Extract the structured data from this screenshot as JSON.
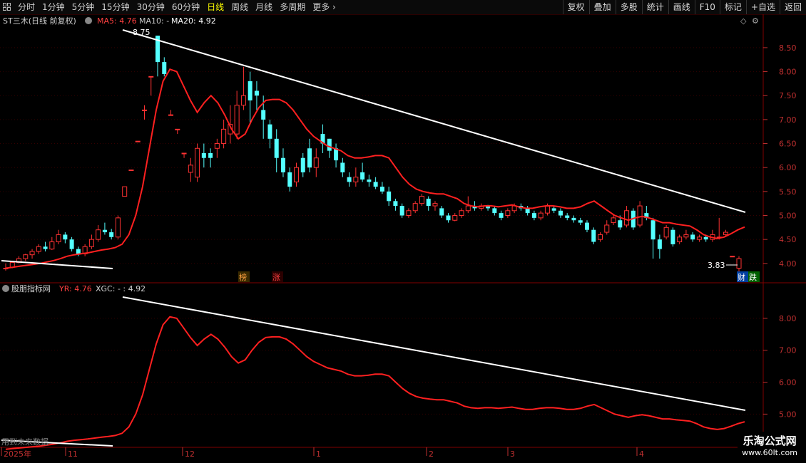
{
  "toolbar": {
    "periods": [
      "分时",
      "1分钟",
      "5分钟",
      "15分钟",
      "30分钟",
      "60分钟",
      "日线",
      "周线",
      "月线",
      "多周期",
      "更多"
    ],
    "active_period": "日线",
    "buttons": [
      "复权",
      "叠加",
      "多股",
      "统计",
      "画线",
      "F10",
      "标记",
      "+自选",
      "返回"
    ]
  },
  "main_panel": {
    "title": "ST三木(日线 前复权)",
    "ma5_label": "MA5: 4.76",
    "ma10_label": "MA10: -",
    "ma20_label": "MA20: 4.92",
    "high_marker": "8.75",
    "low_marker": "3.83",
    "tags": [
      "榜",
      "涨",
      "财",
      "跌"
    ]
  },
  "sub_panel": {
    "title": "股朋指标网",
    "yr_label": "YR: 4.76",
    "xgc_label": "XGC: - : 4.92",
    "footer_text": "用到未来数据"
  },
  "watermark": {
    "title": "乐淘公式网",
    "url": "www.60lt.com"
  },
  "colors": {
    "up": "#ff3232",
    "down": "#54ffff",
    "ma_line": "#ff2020",
    "trend_line": "#ffffff",
    "axis": "#c03030"
  },
  "chart_data": [
    {
      "type": "candlestick",
      "title": "ST三木(日线 前复权)",
      "y_ticks": [
        "8.50",
        "8.00",
        "7.50",
        "7.00",
        "6.50",
        "6.00",
        "5.50",
        "5.00",
        "4.50",
        "4.00"
      ],
      "x_ticks": [
        "2025年",
        "11",
        "12",
        "1",
        "2",
        "3",
        "4"
      ],
      "ylim": [
        3.7,
        8.9
      ],
      "series": [
        {
          "name": "MA5",
          "last": 4.76
        },
        {
          "name": "MA20",
          "last": 4.92
        }
      ],
      "candles": [
        [
          3.9,
          3.9,
          4.0,
          3.85
        ],
        [
          3.92,
          4.02,
          4.05,
          3.9
        ],
        [
          4.02,
          4.1,
          4.15,
          4.0
        ],
        [
          4.1,
          4.18,
          4.2,
          4.05
        ],
        [
          4.18,
          4.25,
          4.3,
          4.1
        ],
        [
          4.25,
          4.35,
          4.4,
          4.2
        ],
        [
          4.35,
          4.3,
          4.45,
          4.25
        ],
        [
          4.3,
          4.45,
          4.55,
          4.28
        ],
        [
          4.45,
          4.6,
          4.7,
          4.4
        ],
        [
          4.6,
          4.5,
          4.65,
          4.42
        ],
        [
          4.5,
          4.3,
          4.55,
          4.25
        ],
        [
          4.3,
          4.2,
          4.35,
          4.15
        ],
        [
          4.2,
          4.35,
          4.4,
          4.15
        ],
        [
          4.35,
          4.5,
          4.6,
          4.3
        ],
        [
          4.5,
          4.7,
          4.8,
          4.45
        ],
        [
          4.7,
          4.65,
          4.85,
          4.6
        ],
        [
          4.65,
          4.55,
          4.72,
          4.5
        ],
        [
          4.55,
          4.95,
          5.0,
          4.5
        ],
        [
          5.4,
          5.6,
          5.6,
          5.4
        ],
        [
          5.95,
          5.95,
          5.95,
          5.95
        ],
        [
          6.55,
          6.55,
          6.55,
          6.55
        ],
        [
          7.2,
          7.2,
          7.3,
          7.0
        ],
        [
          7.9,
          7.9,
          7.9,
          7.5
        ],
        [
          8.75,
          8.2,
          8.75,
          7.9
        ],
        [
          8.2,
          7.95,
          8.3,
          7.9
        ],
        [
          7.1,
          7.1,
          7.2,
          7.1
        ],
        [
          6.8,
          6.8,
          6.8,
          6.7
        ],
        [
          6.3,
          6.3,
          6.3,
          6.2
        ],
        [
          5.9,
          6.05,
          6.2,
          5.7
        ],
        [
          5.8,
          6.4,
          6.5,
          5.7
        ],
        [
          6.3,
          6.2,
          6.5,
          6.0
        ],
        [
          6.3,
          6.2,
          6.4,
          6.0
        ],
        [
          6.4,
          6.5,
          6.6,
          6.2
        ],
        [
          6.5,
          6.8,
          7.0,
          6.4
        ],
        [
          6.7,
          6.9,
          7.3,
          6.5
        ],
        [
          6.7,
          7.3,
          7.6,
          6.6
        ],
        [
          7.3,
          7.5,
          8.1,
          7.2
        ],
        [
          7.8,
          7.4,
          8.0,
          6.9
        ],
        [
          7.6,
          7.5,
          7.8,
          7.2
        ],
        [
          7.2,
          7.0,
          7.5,
          6.6
        ],
        [
          6.9,
          6.6,
          7.0,
          6.4
        ],
        [
          6.6,
          6.2,
          6.8,
          5.9
        ],
        [
          6.2,
          5.9,
          6.4,
          5.8
        ],
        [
          5.9,
          5.6,
          6.0,
          5.5
        ],
        [
          5.7,
          6.0,
          6.1,
          5.6
        ],
        [
          6.2,
          5.9,
          6.3,
          5.8
        ],
        [
          6.4,
          6.0,
          6.6,
          5.9
        ],
        [
          6.0,
          6.2,
          6.4,
          5.8
        ],
        [
          6.7,
          6.5,
          6.9,
          6.3
        ],
        [
          6.6,
          6.35,
          6.6,
          6.2
        ],
        [
          6.4,
          6.15,
          6.5,
          6.0
        ],
        [
          6.1,
          5.9,
          6.2,
          5.8
        ],
        [
          5.8,
          5.7,
          5.9,
          5.6
        ],
        [
          5.7,
          5.8,
          6.0,
          5.6
        ],
        [
          5.9,
          5.75,
          6.1,
          5.7
        ],
        [
          5.75,
          5.7,
          5.85,
          5.6
        ],
        [
          5.7,
          5.6,
          5.8,
          5.55
        ],
        [
          5.6,
          5.5,
          5.7,
          5.45
        ],
        [
          5.5,
          5.3,
          5.6,
          5.2
        ],
        [
          5.3,
          5.2,
          5.35,
          5.1
        ],
        [
          5.2,
          5.0,
          5.25,
          4.95
        ],
        [
          5.0,
          5.1,
          5.15,
          4.95
        ],
        [
          5.1,
          5.25,
          5.3,
          5.05
        ],
        [
          5.25,
          5.4,
          5.45,
          5.2
        ],
        [
          5.35,
          5.2,
          5.4,
          5.1
        ],
        [
          5.2,
          5.25,
          5.3,
          5.1
        ],
        [
          5.15,
          5.0,
          5.2,
          4.95
        ],
        [
          5.0,
          4.9,
          5.05,
          4.85
        ],
        [
          4.9,
          5.0,
          5.05,
          4.88
        ],
        [
          5.0,
          5.1,
          5.15,
          4.95
        ],
        [
          5.1,
          5.2,
          5.4,
          5.05
        ],
        [
          5.2,
          5.15,
          5.3,
          5.1
        ],
        [
          5.15,
          5.2,
          5.25,
          5.1
        ],
        [
          5.2,
          5.15,
          5.22,
          5.1
        ],
        [
          5.15,
          5.05,
          5.2,
          5.0
        ],
        [
          5.05,
          4.95,
          5.1,
          4.9
        ],
        [
          5.0,
          5.1,
          5.15,
          4.95
        ],
        [
          5.1,
          5.2,
          5.25,
          5.05
        ],
        [
          5.2,
          5.15,
          5.25,
          5.1
        ],
        [
          5.15,
          5.05,
          5.2,
          5.0
        ],
        [
          5.05,
          4.95,
          5.1,
          4.9
        ],
        [
          4.95,
          5.05,
          5.1,
          4.9
        ],
        [
          5.05,
          5.2,
          5.25,
          5.0
        ],
        [
          5.15,
          5.1,
          5.2,
          5.05
        ],
        [
          5.1,
          5.0,
          5.15,
          4.95
        ],
        [
          5.0,
          4.95,
          5.05,
          4.9
        ],
        [
          4.95,
          4.9,
          5.0,
          4.85
        ],
        [
          4.9,
          4.85,
          4.95,
          4.8
        ],
        [
          4.85,
          4.7,
          4.9,
          4.65
        ],
        [
          4.7,
          4.45,
          4.75,
          4.4
        ],
        [
          4.5,
          4.6,
          4.65,
          4.45
        ],
        [
          4.65,
          4.8,
          4.9,
          4.6
        ],
        [
          4.85,
          4.95,
          5.0,
          4.8
        ],
        [
          4.9,
          4.75,
          5.0,
          4.7
        ],
        [
          4.8,
          5.1,
          5.2,
          4.75
        ],
        [
          5.1,
          4.75,
          5.15,
          4.7
        ],
        [
          4.8,
          5.2,
          5.3,
          4.75
        ],
        [
          5.05,
          4.95,
          5.2,
          4.9
        ],
        [
          4.9,
          4.5,
          4.95,
          4.1
        ],
        [
          4.5,
          4.3,
          4.6,
          4.1
        ],
        [
          4.55,
          4.75,
          4.8,
          4.5
        ],
        [
          4.7,
          4.4,
          4.75,
          4.35
        ],
        [
          4.45,
          4.55,
          4.6,
          4.4
        ],
        [
          4.55,
          4.6,
          4.7,
          4.5
        ],
        [
          4.6,
          4.5,
          4.65,
          4.45
        ],
        [
          4.5,
          4.55,
          4.6,
          4.45
        ],
        [
          4.55,
          4.5,
          4.6,
          4.45
        ],
        [
          4.5,
          4.6,
          4.7,
          4.45
        ],
        [
          4.55,
          4.55,
          4.95,
          4.5
        ],
        [
          4.6,
          4.65,
          4.7,
          4.55
        ],
        [
          4.15,
          4.15,
          4.15,
          4.15
        ],
        [
          3.9,
          4.1,
          4.15,
          3.83
        ]
      ],
      "ma_line": [
        3.9,
        3.92,
        3.94,
        3.96,
        3.98,
        4.0,
        4.03,
        4.06,
        4.1,
        4.15,
        4.18,
        4.2,
        4.22,
        4.25,
        4.28,
        4.3,
        4.33,
        4.4,
        4.6,
        5.0,
        5.6,
        6.4,
        7.2,
        7.8,
        8.05,
        8.0,
        7.7,
        7.4,
        7.15,
        7.35,
        7.5,
        7.35,
        7.1,
        6.8,
        6.6,
        6.7,
        7.0,
        7.25,
        7.4,
        7.42,
        7.42,
        7.35,
        7.2,
        7.0,
        6.8,
        6.65,
        6.55,
        6.45,
        6.4,
        6.35,
        6.25,
        6.2,
        6.2,
        6.22,
        6.25,
        6.25,
        6.2,
        6.0,
        5.8,
        5.65,
        5.55,
        5.5,
        5.47,
        5.45,
        5.45,
        5.4,
        5.35,
        5.25,
        5.2,
        5.18,
        5.2,
        5.2,
        5.18,
        5.2,
        5.22,
        5.18,
        5.15,
        5.15,
        5.18,
        5.2,
        5.2,
        5.18,
        5.15,
        5.15,
        5.18,
        5.25,
        5.3,
        5.2,
        5.1,
        5.0,
        4.95,
        4.9,
        4.95,
        4.98,
        4.95,
        4.9,
        4.85,
        4.85,
        4.82,
        4.8,
        4.78,
        4.7,
        4.6,
        4.55,
        4.52,
        4.55,
        4.62,
        4.7,
        4.76
      ]
    },
    {
      "type": "line",
      "title": "股朋指标网",
      "y_ticks": [
        "8.00",
        "7.00",
        "6.00",
        "5.00"
      ],
      "series": [
        {
          "name": "YR",
          "last": 4.76
        },
        {
          "name": "XGC",
          "last": 4.92
        }
      ]
    }
  ]
}
